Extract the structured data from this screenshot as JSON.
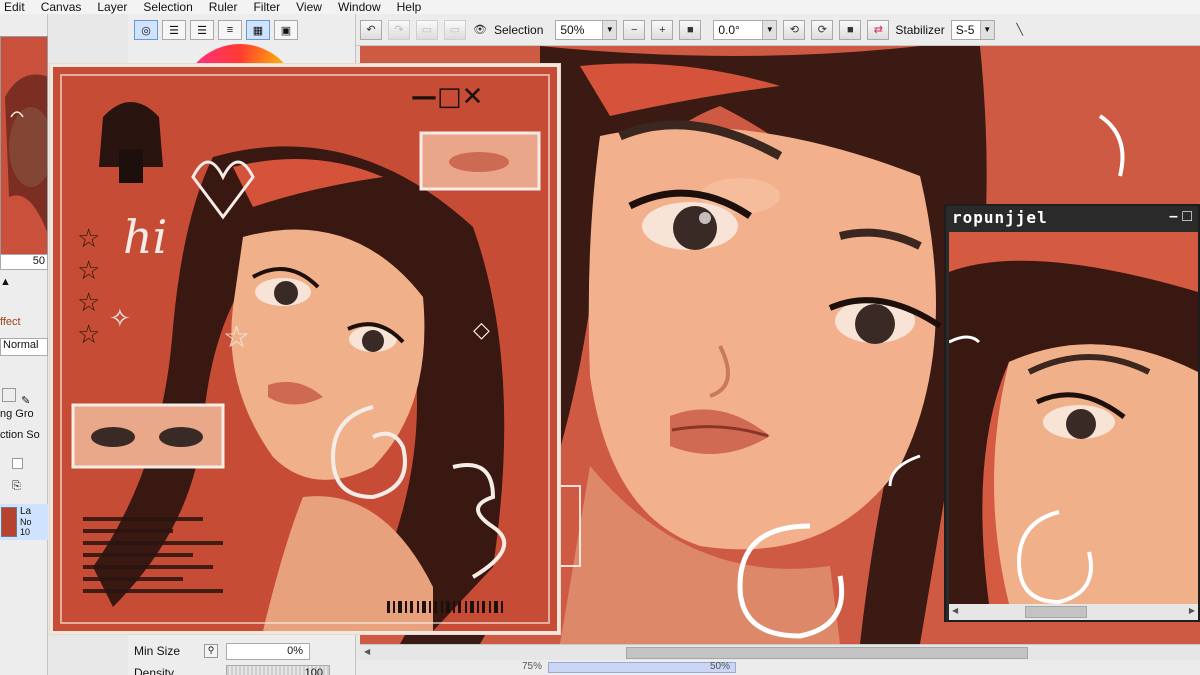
{
  "menu": [
    "Edit",
    "Canvas",
    "Layer",
    "Selection",
    "Ruler",
    "Filter",
    "View",
    "Window",
    "Help"
  ],
  "toolbar": {
    "selection_label": "Selection",
    "zoom_value": "50%",
    "rotation_value": "0.0°",
    "stabilizer_label": "Stabilizer",
    "stabilizer_value": "S-5"
  },
  "left_panel": {
    "opacity_value": "50",
    "effect_label": "ffect",
    "blend_value": "Normal",
    "group_label": "ng Gro",
    "source_label": "ction So",
    "layer_name": "La",
    "layer_mode": "No",
    "layer_opacity": "10"
  },
  "brush_panel": {
    "min_size_label": "Min Size",
    "min_size_value": "0%",
    "density_label": "Density",
    "density_value": "100"
  },
  "status": {
    "left_zoom": "75%",
    "right_zoom": "50%"
  },
  "artwork": {
    "window_controls": "—□✕",
    "doodle_text": "hi"
  },
  "navigator": {
    "title": "ropunjjel",
    "controls": "– □"
  },
  "colors": {
    "canvas_bg": "#cf5a43",
    "accent_selection": "#cfe3ff",
    "stabilizer_icon": "#d12c5c"
  }
}
